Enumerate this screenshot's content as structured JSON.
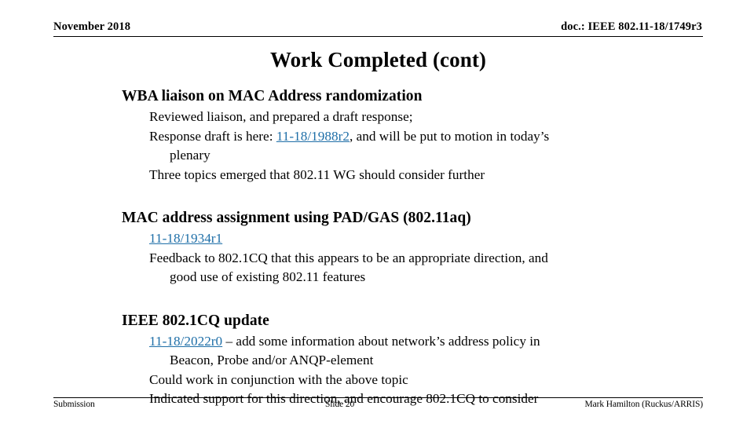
{
  "header": {
    "date": "November 2018",
    "doc": "doc.: IEEE 802.11-18/1749r3"
  },
  "title": "Work Completed (cont)",
  "sections": [
    {
      "heading": "WBA liaison on MAC Address randomization",
      "lines": [
        {
          "text": "Reviewed liaison, and prepared a draft response;"
        },
        {
          "pre": "Response draft is here: ",
          "link": "11-18/1988r2",
          "post": ", and will be put to motion in today’s"
        },
        {
          "text": "plenary",
          "indent": true
        },
        {
          "text": "Three topics emerged that 802.11 WG should consider further"
        }
      ]
    },
    {
      "heading": "MAC address assignment using PAD/GAS (802.11aq)",
      "lines": [
        {
          "pre": "",
          "link": "11-18/1934r1",
          "post": ""
        },
        {
          "text": "Feedback to 802.1CQ that this appears to be an appropriate direction, and"
        },
        {
          "text": "good use of existing 802.11 features",
          "indent": true
        }
      ]
    },
    {
      "heading": "IEEE 802.1CQ update",
      "lines": [
        {
          "pre": "",
          "link": "11-18/2022r0",
          "post": " – add some information about network’s address policy in"
        },
        {
          "text": "Beacon, Probe and/or ANQP-element",
          "indent": true
        },
        {
          "text": "Could work in conjunction with the above topic"
        },
        {
          "text": "Indicated support for this direction, and encourage 802.1CQ to consider"
        }
      ]
    }
  ],
  "footer": {
    "left": "Submission",
    "slide": "Slide 20",
    "right": "Mark Hamilton (Ruckus/ARRIS)"
  },
  "colors": {
    "link": "#1F6FA8",
    "text": "#000000",
    "background": "#FFFFFF"
  }
}
